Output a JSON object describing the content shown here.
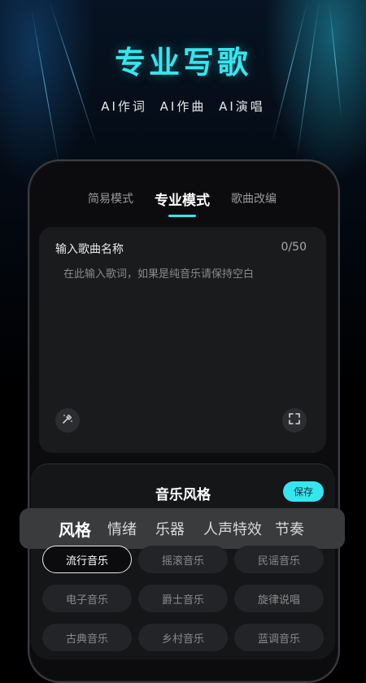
{
  "hero": {
    "title": "专业写歌",
    "features": [
      "AI作词",
      "AI作曲",
      "AI演唱"
    ]
  },
  "mode_tabs": [
    {
      "label": "简易模式",
      "active": false
    },
    {
      "label": "专业模式",
      "active": true
    },
    {
      "label": "歌曲改编",
      "active": false
    }
  ],
  "lyric_card": {
    "song_name_label": "输入歌曲名称",
    "char_count": "0/50",
    "placeholder": "在此输入歌词，如果是纯音乐请保持空白"
  },
  "style_panel": {
    "title": "音乐风格",
    "save_label": "保存",
    "categories": [
      {
        "label": "风格",
        "active": true
      },
      {
        "label": "情绪",
        "active": false
      },
      {
        "label": "乐器",
        "active": false
      },
      {
        "label": "人声特效",
        "active": false
      },
      {
        "label": "节奏",
        "active": false
      }
    ],
    "styles": [
      {
        "label": "流行音乐",
        "selected": true
      },
      {
        "label": "摇滚音乐",
        "selected": false
      },
      {
        "label": "民谣音乐",
        "selected": false
      },
      {
        "label": "电子音乐",
        "selected": false
      },
      {
        "label": "爵士音乐",
        "selected": false
      },
      {
        "label": "旋律说唱",
        "selected": false
      },
      {
        "label": "古典音乐",
        "selected": false
      },
      {
        "label": "乡村音乐",
        "selected": false
      },
      {
        "label": "蓝调音乐",
        "selected": false
      }
    ]
  },
  "colors": {
    "accent": "#35e6ee",
    "background": "#000000",
    "card": "#1a1b1d"
  },
  "icons": {
    "lyric_assist": "magic-wand-icon",
    "expand": "fullscreen-icon"
  }
}
